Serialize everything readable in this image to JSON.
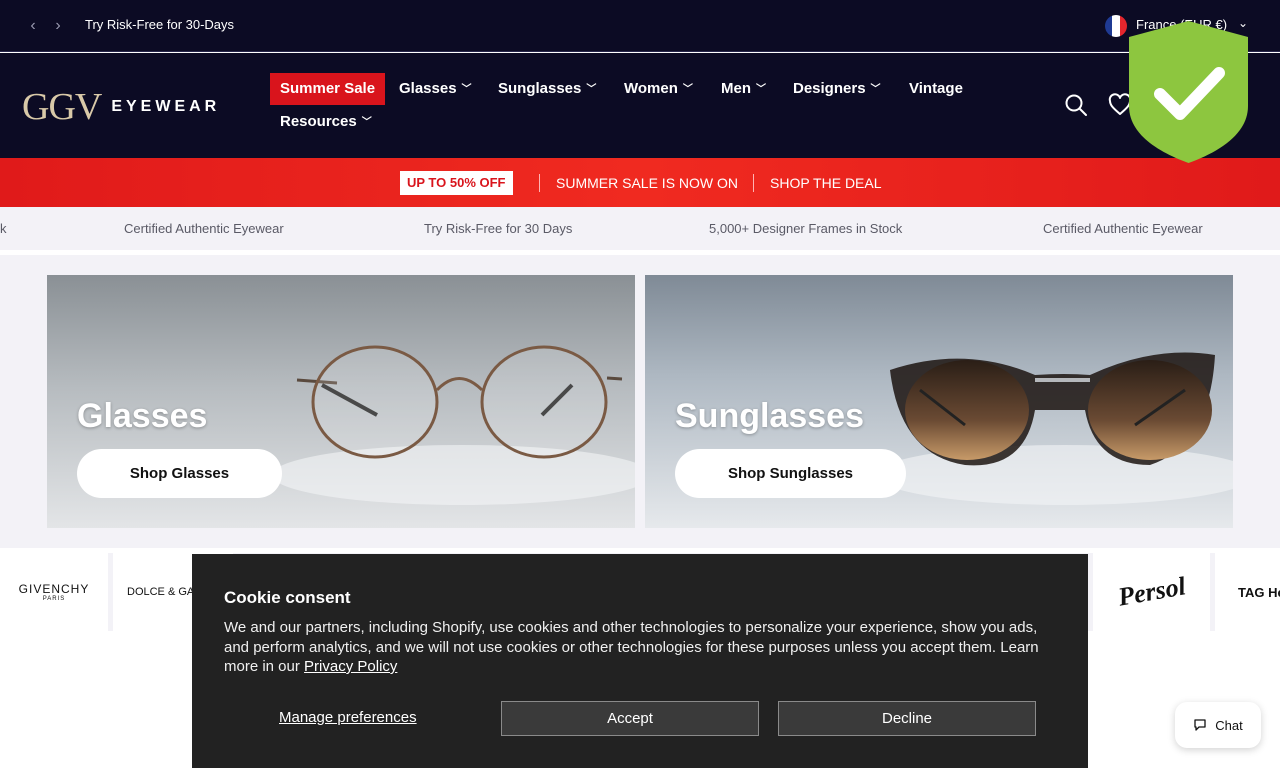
{
  "announcement": {
    "message": "Try Risk-Free for 30-Days",
    "prev_icon": "chevron-left-icon",
    "next_icon": "chevron-right-icon",
    "country": "France (EUR €)"
  },
  "header": {
    "logo_mark": "GGV",
    "logo_word": "EYEWEAR",
    "nav": [
      {
        "label": "Summer Sale"
      },
      {
        "label": "Glasses"
      },
      {
        "label": "Sunglasses"
      },
      {
        "label": "Women"
      },
      {
        "label": "Men"
      },
      {
        "label": "Designers"
      },
      {
        "label": "Vintage"
      },
      {
        "label": "Resources"
      }
    ],
    "icons": [
      "search-icon",
      "heart-icon"
    ]
  },
  "promo": {
    "badge": "UP TO 50% OFF",
    "message": "SUMMER SALE IS NOW ON",
    "cta": "SHOP THE DEAL"
  },
  "ticker": {
    "items": [
      "k",
      "Certified Authentic Eyewear",
      "Try Risk-Free for 30 Days",
      "5,000+ Designer Frames in Stock",
      "Certified Authentic Eyewear"
    ]
  },
  "hero": {
    "cards": [
      {
        "title": "Glasses",
        "button": "Shop Glasses"
      },
      {
        "title": "Sunglasses",
        "button": "Shop Sunglasses"
      }
    ]
  },
  "brands": {
    "logos": [
      {
        "name": "GIVENCHY",
        "sub": "PARIS"
      },
      {
        "name": "DOLCE & GABBANA"
      },
      {
        "name": "Persol"
      },
      {
        "name": "TAG Heuer"
      }
    ]
  },
  "cookie": {
    "title": "Cookie consent",
    "body": "We and our partners, including Shopify, use cookies and other technologies to personalize your experience, show you ads, and perform analytics, and we will not use cookies or other technologies for these purposes unless you accept them. Learn more in our",
    "policy_link": "Privacy Policy",
    "manage": "Manage preferences",
    "accept": "Accept",
    "decline": "Decline"
  },
  "chat": {
    "label": "Chat"
  },
  "colors": {
    "header_bg": "#0c0b24",
    "sale_red": "#d9141c",
    "shield_green": "#8dc63f"
  }
}
